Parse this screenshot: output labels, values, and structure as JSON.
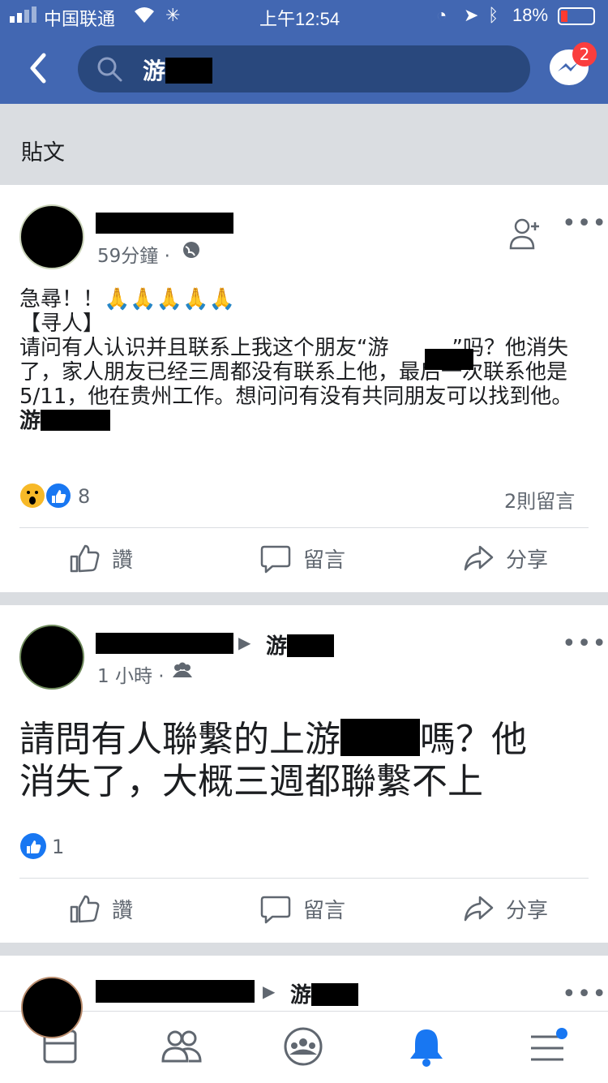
{
  "status_bar": {
    "carrier": "中国联通",
    "time": "上午12:54",
    "battery": "18%"
  },
  "header": {
    "search_query": "游",
    "messenger_badge": "2"
  },
  "section_title": "貼文",
  "posts": [
    {
      "time": "59分鐘 ·",
      "text": "急尋！！🙏🙏🙏🙏🙏\n【寻人】\n请问有人认识并且联系上我这个朋友“游　　　”吗？他消失了，家人朋友已经三周都没有联系上他，最后一次联系他是5/11，他在贵州工作。想问问有没有共同朋友可以找到他。",
      "tag": "游",
      "reaction_count": "8",
      "comments": "2則留言",
      "actions": {
        "like": "讚",
        "comment": "留言",
        "share": "分享"
      }
    },
    {
      "time": "1 小時 ·",
      "target": "游",
      "text": "請問有人聯繫的上游",
      "text2": "嗎？他",
      "text3": "消失了，大概三週都聯繫不上",
      "reaction_count": "1",
      "actions": {
        "like": "讚",
        "comment": "留言",
        "share": "分享"
      }
    },
    {
      "target": "游"
    }
  ],
  "colors": {
    "brand": "#4267b2",
    "like_blue": "#1877f2"
  }
}
